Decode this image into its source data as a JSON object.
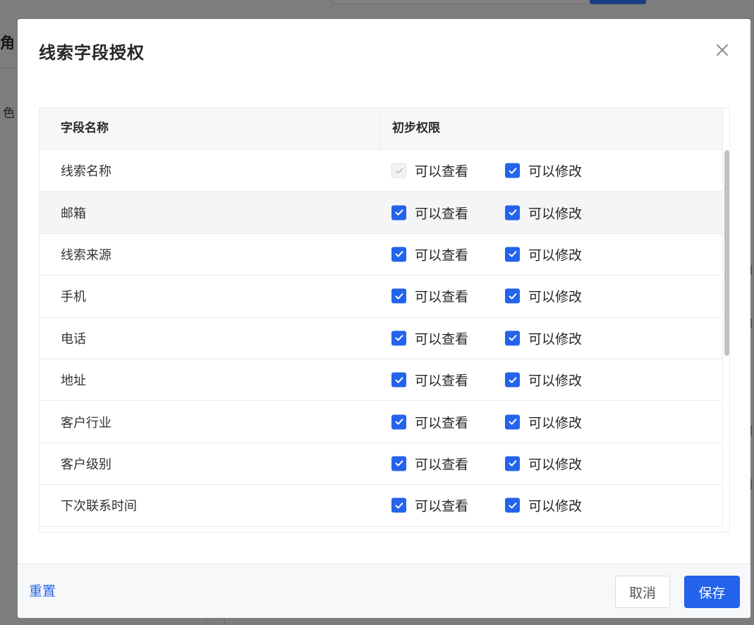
{
  "background": {
    "left_heading": "角",
    "left_item": "色"
  },
  "dialog": {
    "title": "线索字段授权",
    "close_icon": "close-icon"
  },
  "table": {
    "columns": [
      "字段名称",
      "初步权限"
    ],
    "rows": [
      {
        "name": "线索名称",
        "view_label": "可以查看",
        "edit_label": "可以修改",
        "view_checked": true,
        "view_disabled": true,
        "edit_checked": true
      },
      {
        "name": "邮箱",
        "view_label": "可以查看",
        "edit_label": "可以修改",
        "view_checked": true,
        "view_disabled": false,
        "edit_checked": true
      },
      {
        "name": "线索来源",
        "view_label": "可以查看",
        "edit_label": "可以修改",
        "view_checked": true,
        "view_disabled": false,
        "edit_checked": true
      },
      {
        "name": "手机",
        "view_label": "可以查看",
        "edit_label": "可以修改",
        "view_checked": true,
        "view_disabled": false,
        "edit_checked": true
      },
      {
        "name": "电话",
        "view_label": "可以查看",
        "edit_label": "可以修改",
        "view_checked": true,
        "view_disabled": false,
        "edit_checked": true
      },
      {
        "name": "地址",
        "view_label": "可以查看",
        "edit_label": "可以修改",
        "view_checked": true,
        "view_disabled": false,
        "edit_checked": true
      },
      {
        "name": "客户行业",
        "view_label": "可以查看",
        "edit_label": "可以修改",
        "view_checked": true,
        "view_disabled": false,
        "edit_checked": true
      },
      {
        "name": "客户级别",
        "view_label": "可以查看",
        "edit_label": "可以修改",
        "view_checked": true,
        "view_disabled": false,
        "edit_checked": true
      },
      {
        "name": "下次联系时间",
        "view_label": "可以查看",
        "edit_label": "可以修改",
        "view_checked": true,
        "view_disabled": false,
        "edit_checked": true
      }
    ]
  },
  "footer": {
    "reset_label": "重置",
    "cancel_label": "取消",
    "save_label": "保存"
  },
  "colors": {
    "primary": "#2463eb",
    "overlay": "#7d7d7d",
    "row_hover": "#f4f5f7"
  }
}
